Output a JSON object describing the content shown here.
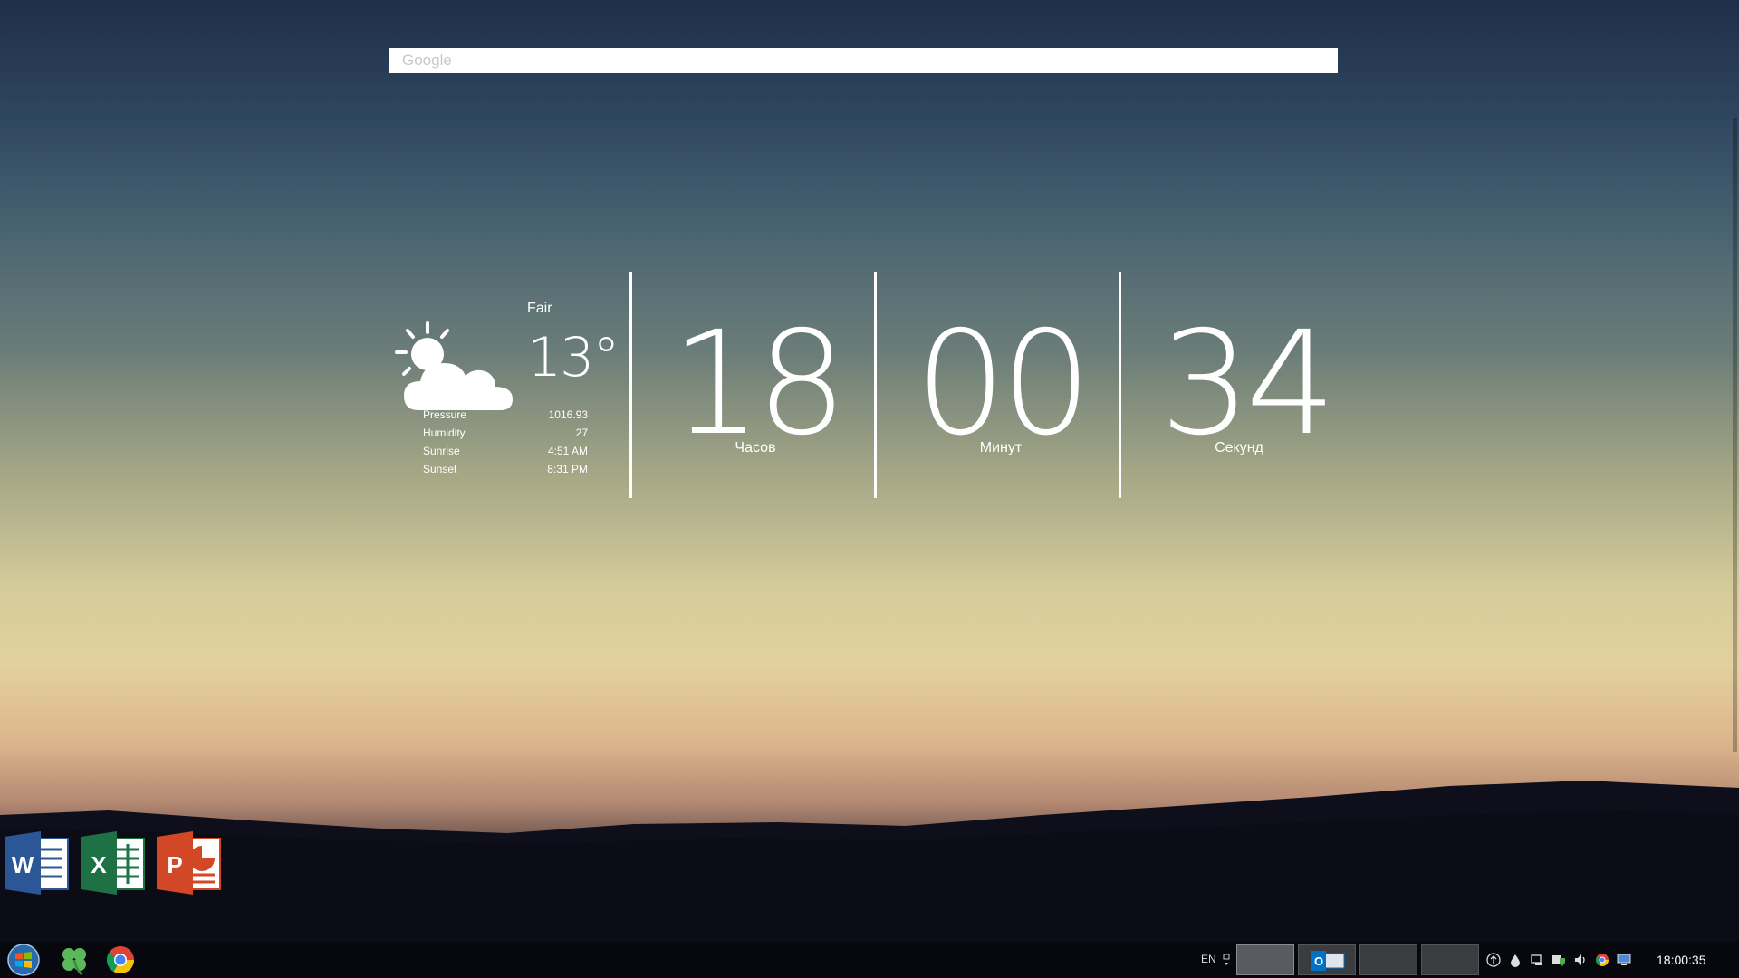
{
  "search": {
    "placeholder": "Google"
  },
  "weather": {
    "condition": "Fair",
    "temperature": "13°",
    "stats": [
      {
        "label": "Pressure",
        "value": "1016.93"
      },
      {
        "label": "Humidity",
        "value": "27"
      },
      {
        "label": "Sunrise",
        "value": "4:51 AM"
      },
      {
        "label": "Sunset",
        "value": "8:31 PM"
      }
    ]
  },
  "clock_widget": {
    "hours": "18",
    "hours_label": "Часов",
    "minutes": "00",
    "minutes_label": "Минут",
    "seconds": "34",
    "seconds_label": "Секунд"
  },
  "desktop_icons": [
    {
      "name": "word",
      "letter": "W",
      "color": "#2b5797"
    },
    {
      "name": "excel",
      "letter": "X",
      "color": "#1e7145"
    },
    {
      "name": "powerpoint",
      "letter": "P",
      "color": "#d24726"
    }
  ],
  "taskbar": {
    "language": "EN",
    "clock": "18:00:35",
    "outlook_letter": "O"
  }
}
